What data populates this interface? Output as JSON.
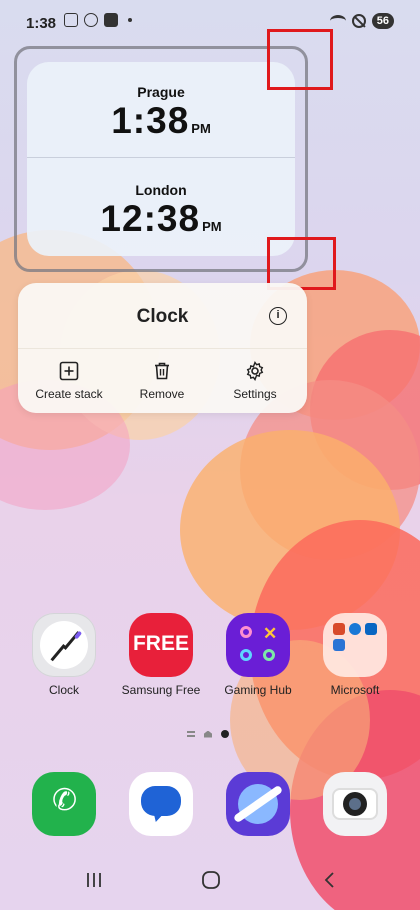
{
  "status_bar": {
    "time": "1:38",
    "battery": "56"
  },
  "widget": {
    "clocks": [
      {
        "city": "Prague",
        "time": "1:38",
        "ampm": "PM"
      },
      {
        "city": "London",
        "time": "12:38",
        "ampm": "PM"
      }
    ]
  },
  "context_menu": {
    "title": "Clock",
    "actions": [
      {
        "label": "Create stack",
        "icon": "add-square-icon"
      },
      {
        "label": "Remove",
        "icon": "trash-icon"
      },
      {
        "label": "Settings",
        "icon": "gear-icon"
      }
    ]
  },
  "apps": [
    {
      "label": "Clock",
      "icon": "clock-icon"
    },
    {
      "label": "Samsung Free",
      "icon": "samsung-free-icon",
      "tile_text": "FREE"
    },
    {
      "label": "Gaming Hub",
      "icon": "gaming-hub-icon"
    },
    {
      "label": "Microsoft",
      "icon": "folder-icon"
    }
  ],
  "dock": [
    {
      "icon": "phone-icon"
    },
    {
      "icon": "messages-icon"
    },
    {
      "icon": "internet-icon"
    },
    {
      "icon": "camera-icon"
    }
  ],
  "colors": {
    "highlight": "#e0191c",
    "free_tile": "#e8203a",
    "gaming_tile": "#6a1ed6"
  }
}
